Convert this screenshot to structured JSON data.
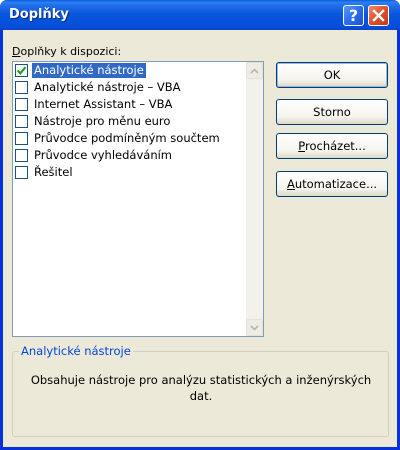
{
  "window": {
    "title": "Doplňky",
    "help_label": "?",
    "close_icon": "close-icon"
  },
  "list": {
    "label": "Doplňky k dispozici:",
    "items": [
      {
        "label": "Analytické nástroje",
        "checked": true,
        "selected": true
      },
      {
        "label": "Analytické nástroje – VBA",
        "checked": false,
        "selected": false
      },
      {
        "label": "Internet Assistant – VBA",
        "checked": false,
        "selected": false
      },
      {
        "label": "Nástroje pro měnu euro",
        "checked": false,
        "selected": false
      },
      {
        "label": "Průvodce podmíněným součtem",
        "checked": false,
        "selected": false
      },
      {
        "label": "Průvodce vyhledáváním",
        "checked": false,
        "selected": false
      },
      {
        "label": "Řešitel",
        "checked": false,
        "selected": false
      }
    ]
  },
  "buttons": {
    "ok": "OK",
    "cancel": "Storno",
    "browse": "Procházet...",
    "automation": "Automatizace..."
  },
  "details": {
    "title": "Analytické nástroje",
    "description": "Obsahuje nástroje pro analýzu statistických a inženýrských dat."
  },
  "colors": {
    "titlebar": "#0a58e0",
    "selection": "#316ac5",
    "groupbox_title": "#0046d5",
    "check": "#21a121"
  }
}
